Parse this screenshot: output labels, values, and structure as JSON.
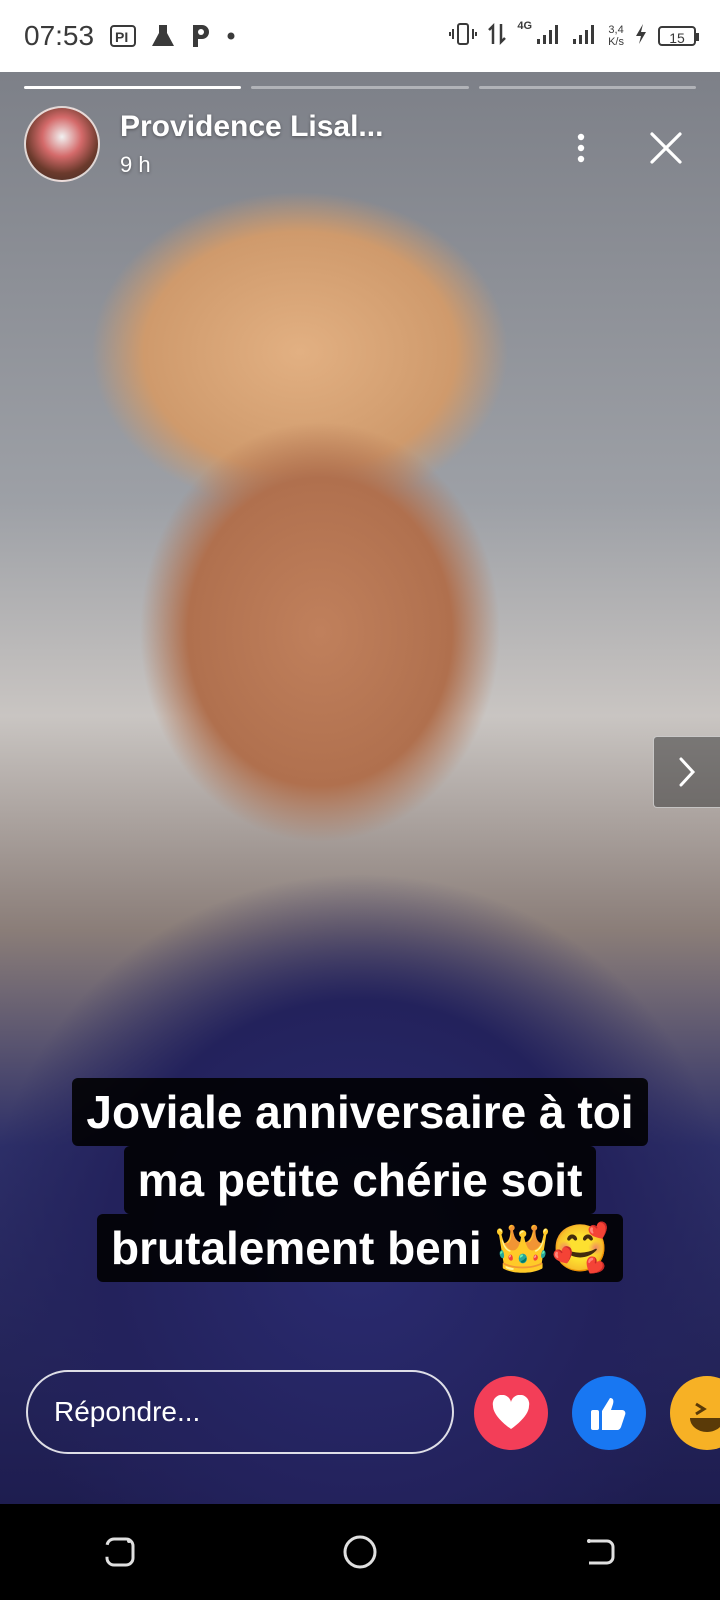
{
  "status_bar": {
    "time": "07:53",
    "left_icons": [
      "pi-app-icon",
      "lab-flask-icon",
      "p-app-icon",
      "dot-icon"
    ],
    "network": "4G",
    "speed_top": "3,4",
    "speed_bottom": "K/s",
    "battery": "15"
  },
  "story": {
    "progress": [
      1.0,
      0.0,
      0.0
    ],
    "author": "Providence Lisal...",
    "time_ago": "9 h",
    "caption_lines": [
      "Joviale anniversaire à toi",
      "ma petite chérie soit",
      "brutalement beni 👑🥰"
    ]
  },
  "reply": {
    "placeholder": "Répondre..."
  },
  "reactions": [
    "love-icon",
    "like-icon",
    "haha-icon"
  ],
  "colors": {
    "love": "#f33e58",
    "like": "#1877f2",
    "haha": "#f7b125",
    "caption_bg": "#000000"
  },
  "nav": [
    "recent-apps-icon",
    "home-icon",
    "back-icon"
  ]
}
